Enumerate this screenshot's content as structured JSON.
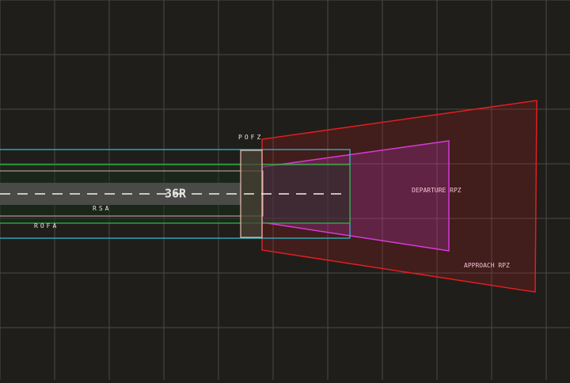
{
  "colors": {
    "background": "#1f1e1b",
    "grid": "#4a4a46",
    "runway": "#4a4a48",
    "centerline": "#f2efe6",
    "rofa": "#2ec4d6",
    "rsa": "#e0a8a8",
    "ofa_green": "#2fbf3f",
    "pofz": "#e8c0b0",
    "departure_rpz": "#d63bd6",
    "approach_rpz": "#e01e1e",
    "label": "#e6e3da",
    "rpz_label": "#f0c0d0"
  },
  "labels": {
    "runway_designator": "36R",
    "pofz": "POFZ",
    "rsa": "RSA",
    "rofa": "ROFA",
    "departure_rpz": "DEPARTURE RPZ",
    "approach_rpz": "APPROACH RPZ"
  }
}
